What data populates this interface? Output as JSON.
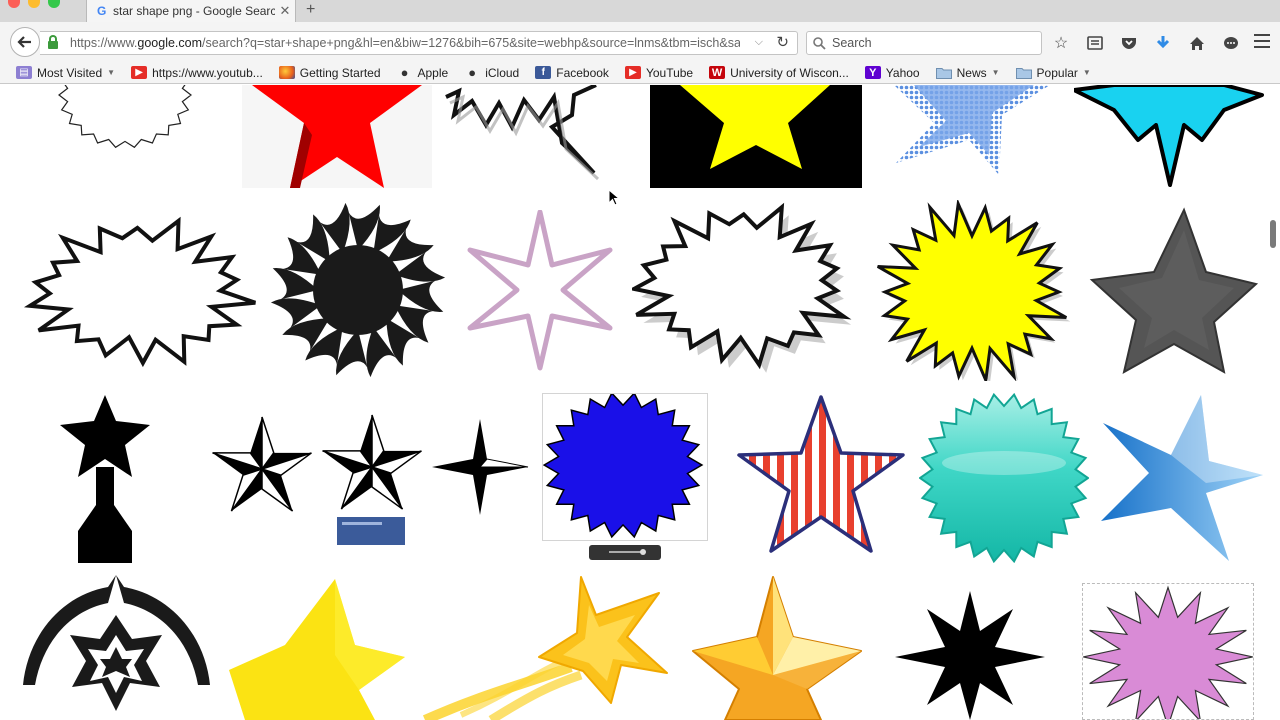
{
  "tab": {
    "title": "star shape png - Google Search"
  },
  "navbar": {
    "url_prefix": "https://www.",
    "url_host": "google.com",
    "url_path": "/search?q=star+shape+png&hl=en&biw=1276&bih=675&site=webhp&source=lnms&tbm=isch&sa=X&\\",
    "search_placeholder": "Search"
  },
  "bookmarks": [
    {
      "label": "Most Visited",
      "icon": "most-visited-icon",
      "dropdown": true
    },
    {
      "label": "https://www.youtub...",
      "icon": "youtube-icon",
      "dropdown": false
    },
    {
      "label": "Getting Started",
      "icon": "firefox-icon",
      "dropdown": false
    },
    {
      "label": "Apple",
      "icon": "apple-icon",
      "dropdown": false
    },
    {
      "label": "iCloud",
      "icon": "apple-icon",
      "dropdown": false
    },
    {
      "label": "Facebook",
      "icon": "facebook-icon",
      "dropdown": false
    },
    {
      "label": "YouTube",
      "icon": "youtube-icon",
      "dropdown": false
    },
    {
      "label": "University of Wiscon...",
      "icon": "uw-icon",
      "dropdown": false
    },
    {
      "label": "Yahoo",
      "icon": "yahoo-icon",
      "dropdown": false
    },
    {
      "label": "News",
      "icon": "folder-icon",
      "dropdown": true
    },
    {
      "label": "Popular",
      "icon": "folder-icon",
      "dropdown": true
    }
  ],
  "results": [
    {
      "name": "result-starburst-outline",
      "description": "white starburst outline"
    },
    {
      "name": "result-red-star",
      "description": "red 3D star"
    },
    {
      "name": "result-speech-burst",
      "description": "black spiky speech burst"
    },
    {
      "name": "result-yellow-star-black",
      "description": "yellow star on black"
    },
    {
      "name": "result-halftone-star",
      "description": "blue halftone star"
    },
    {
      "name": "result-cyan-star",
      "description": "cyan burst star"
    },
    {
      "name": "result-comic-burst",
      "description": "black outline comic burst"
    },
    {
      "name": "result-tribal-sun",
      "description": "black tribal sun"
    },
    {
      "name": "result-purple-star",
      "description": "purple thin 4-point star"
    },
    {
      "name": "result-shadow-burst",
      "description": "shadowed comic burst"
    },
    {
      "name": "result-yellow-burst",
      "description": "yellow spiky burst"
    },
    {
      "name": "result-grey-star",
      "description": "grey textured star"
    },
    {
      "name": "result-trophy-star",
      "description": "black star trophy"
    },
    {
      "name": "result-nautical-stars",
      "description": "three nautical stars"
    },
    {
      "name": "result-blue-seal",
      "description": "blue seal burst"
    },
    {
      "name": "result-striped-star",
      "description": "red striped star"
    },
    {
      "name": "result-teal-seal",
      "description": "teal seal badge"
    },
    {
      "name": "result-blue-gloss-star",
      "description": "blue glossy star"
    },
    {
      "name": "result-tribal-star",
      "description": "black tribal star"
    },
    {
      "name": "result-yellow-star",
      "description": "yellow star"
    },
    {
      "name": "result-shooting-star",
      "description": "yellow shooting star"
    },
    {
      "name": "result-gold-star",
      "description": "gold 3D star"
    },
    {
      "name": "result-black-8point-star",
      "description": "black 8-point star"
    },
    {
      "name": "result-pink-burst",
      "description": "pink burst"
    }
  ],
  "colors": {
    "red": "#ff0000",
    "yellow": "#ffff00",
    "cyan": "#19d2f0",
    "blue": "#1a10e8",
    "purple": "#c9a3c6",
    "grey": "#555555",
    "teal": "#26c9b8",
    "pink": "#d98bd6",
    "gold": "#ffc72a"
  }
}
